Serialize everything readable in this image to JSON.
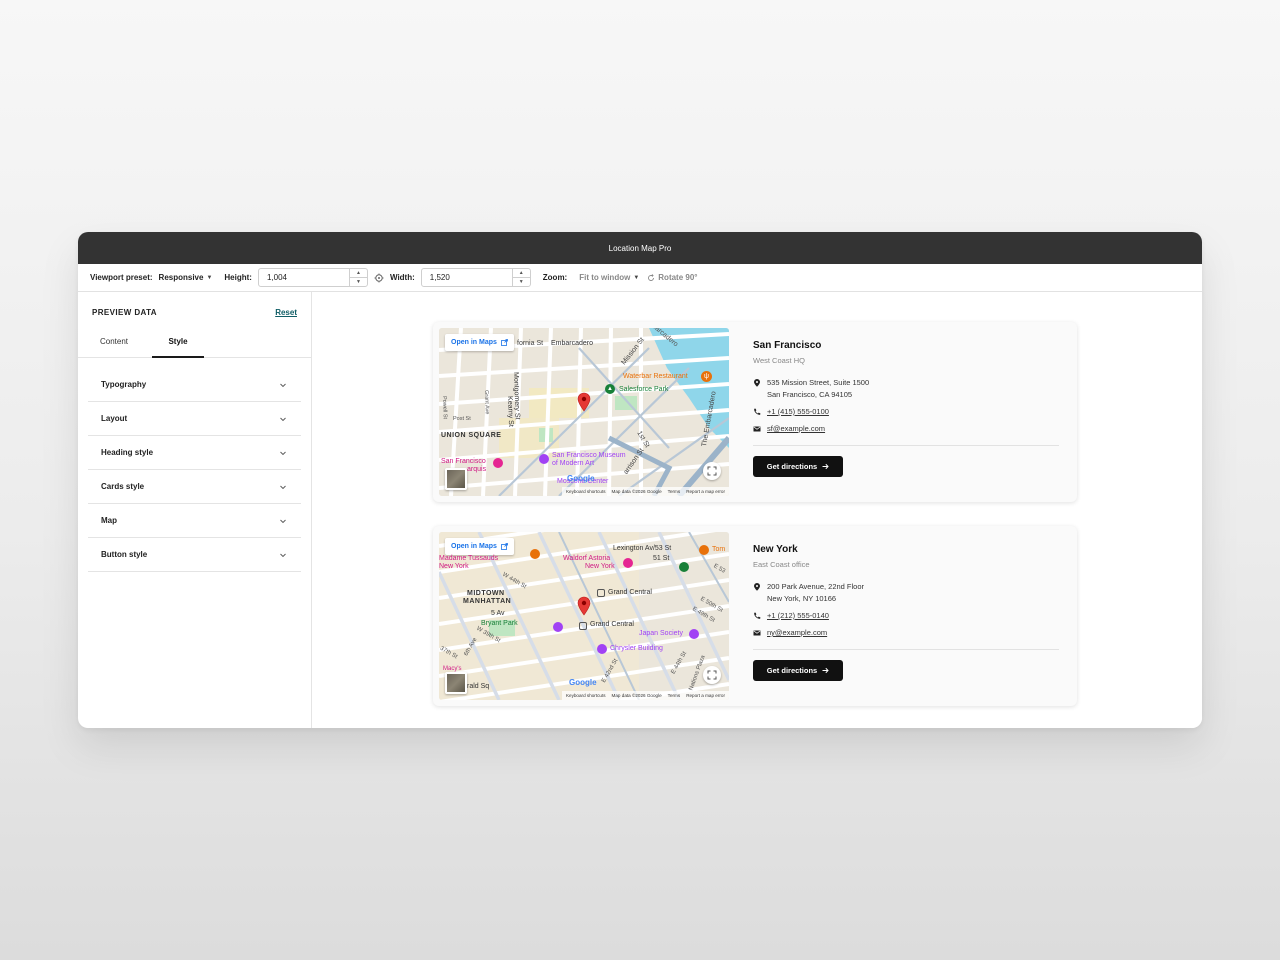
{
  "window": {
    "title": "Location Map Pro"
  },
  "toolbar": {
    "viewport_label": "Viewport preset:",
    "viewport_value": "Responsive",
    "height_label": "Height:",
    "height_value": "1,004",
    "width_label": "Width:",
    "width_value": "1,520",
    "zoom_label": "Zoom:",
    "zoom_value": "Fit to window",
    "rotate_label": "Rotate 90°"
  },
  "sidebar": {
    "title": "PREVIEW DATA",
    "reset_label": "Reset",
    "tabs": [
      {
        "label": "Content",
        "active": false
      },
      {
        "label": "Style",
        "active": true
      }
    ],
    "sections": [
      {
        "label": "Typography"
      },
      {
        "label": "Layout"
      },
      {
        "label": "Heading style"
      },
      {
        "label": "Cards style"
      },
      {
        "label": "Map"
      },
      {
        "label": "Button style"
      }
    ]
  },
  "locations": [
    {
      "city": "San Francisco",
      "subtitle": "West Coast HQ",
      "address_line1": "535 Mission Street, Suite 1500",
      "address_line2": "San Francisco, CA 94105",
      "phone": "+1 (415) 555-0100",
      "email": "sf@example.com",
      "button_label": "Get directions",
      "map": {
        "open_label": "Open in Maps",
        "labels": {
          "embarcadero": "Embarcadero",
          "fornia": "fornia St",
          "waterbar": "Waterbar Restaurant",
          "salesforce": "Salesforce Park",
          "union": "UNION SQUARE",
          "sfmoma1": "San Francisco Museum",
          "sfmoma2": "of Modern Art",
          "sf1": "San Francisco",
          "sf2": "arquis",
          "moscone": "Moscone Center",
          "mission": "Mission St",
          "first": "1st St",
          "kearny": "Kearny St",
          "montgomery": "Montgomery St",
          "post": "Post St",
          "grant": "Grant Ave",
          "powell": "Powell St",
          "barcadero": "barcadero",
          "embarc2": "The Embarcadero",
          "harrison": "arrison St"
        },
        "footer": [
          "Keyboard shortcuts",
          "Map data ©2026 Google",
          "Terms",
          "Report a map error"
        ],
        "google": "Google"
      }
    },
    {
      "city": "New York",
      "subtitle": "East Coast office",
      "address_line1": "200 Park Avenue, 22nd Floor",
      "address_line2": "New York, NY 10166",
      "phone": "+1 (212) 555-0140",
      "email": "ny@example.com",
      "button_label": "Get directions",
      "map": {
        "open_label": "Open in Maps",
        "labels": {
          "lexington": "Lexington Av/53 St",
          "fiftyone": "51 St",
          "tom": "Tom",
          "waldorf1": "Waldorf Astoria",
          "waldorf2": "New York",
          "tussauds1": "Madame Tussauds",
          "tussauds2": "New York",
          "midtown1": "MIDTOWN",
          "midtown2": "MANHATTAN",
          "grandcentral1": "Grand Central",
          "grandcentral2": "Grand Central",
          "fifthav": "5 Av",
          "bryant": "Bryant Park",
          "japan": "Japan Society",
          "chrysler": "Chrysler Building",
          "w44": "W 44th St",
          "e50": "E 50th St",
          "e49": "E 49th St",
          "e44": "E 44th St",
          "e42": "E 42nd St",
          "w39": "W 39th St",
          "th37": "37th St",
          "ave6": "6th Ave",
          "e53": "E 53",
          "nations": "Nations Plaza",
          "herald": "rald Sq",
          "macys": "Macy's"
        },
        "footer": [
          "Keyboard shortcuts",
          "Map data ©2026 Google",
          "Terms",
          "Report a map error"
        ],
        "google": "Google"
      }
    }
  ],
  "colors": {
    "titlebar": "#333333",
    "accent_link": "#0f5d65",
    "button": "#111111",
    "map_blue": "#1a73e8",
    "pin": "#e53935"
  }
}
